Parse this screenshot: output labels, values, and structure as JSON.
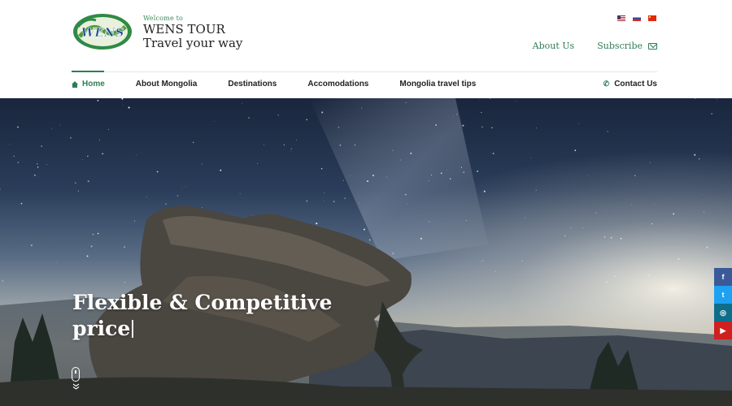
{
  "brand": {
    "welcome": "Welcome to",
    "name": "WENS TOUR",
    "tagline": "Travel your way",
    "logo_text": "WENS"
  },
  "languages": [
    {
      "code": "en",
      "icon": "us-flag-icon"
    },
    {
      "code": "ru",
      "icon": "russia-flag-icon"
    },
    {
      "code": "zh",
      "icon": "china-flag-icon"
    }
  ],
  "top_links": {
    "about": "About Us",
    "subscribe": "Subscribe"
  },
  "nav": {
    "items": [
      {
        "label": "Home",
        "active": true
      },
      {
        "label": "About Mongolia"
      },
      {
        "label": "Destinations"
      },
      {
        "label": "Accomodations"
      },
      {
        "label": "Mongolia travel tips"
      }
    ],
    "contact": "Contact Us"
  },
  "hero": {
    "heading_line1": "Flexible & Competitive",
    "heading_line2": "price"
  },
  "social": {
    "facebook": "f",
    "twitter": "t",
    "instagram": "◎",
    "youtube": "▶"
  },
  "colors": {
    "accent": "#2f7d55",
    "facebook": "#3b5998",
    "twitter": "#1da1f2",
    "instagram": "#0e6d8a",
    "youtube": "#cd201f"
  }
}
